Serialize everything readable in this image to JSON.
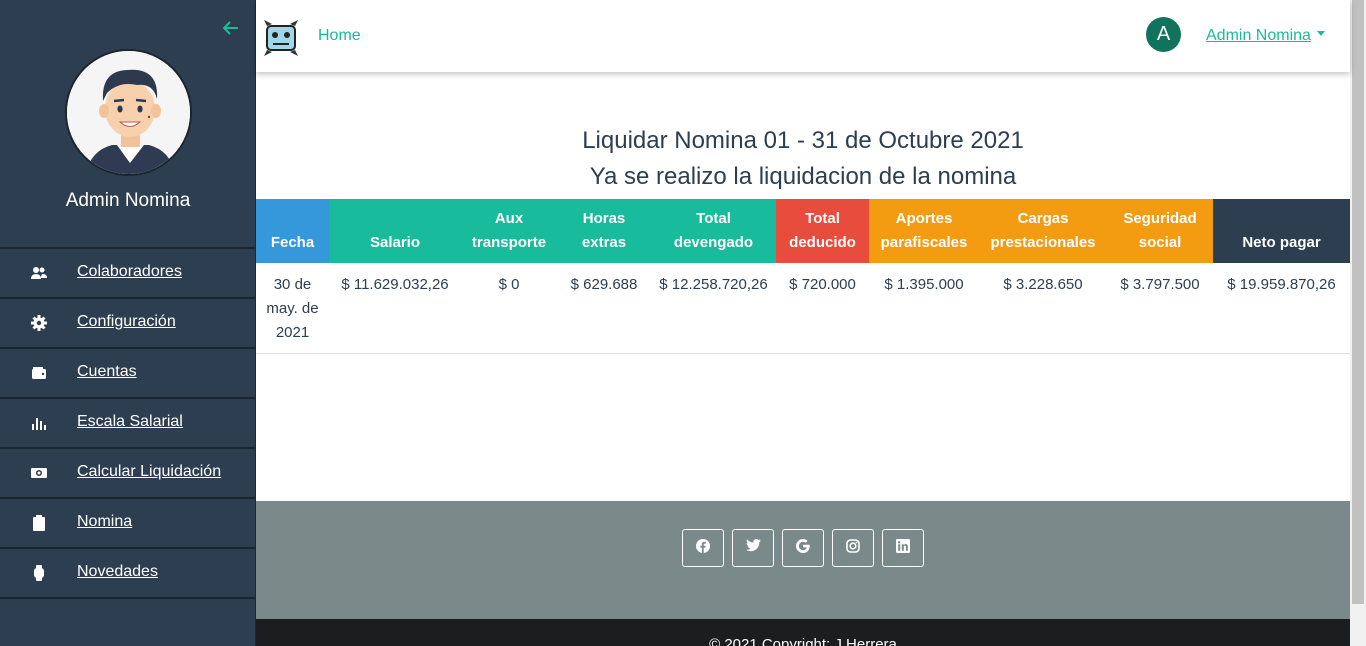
{
  "sidebar": {
    "back_icon": "arrow-left-icon",
    "user_name": "Admin Nomina",
    "items": [
      {
        "label": "Colaboradores",
        "icon": "users-icon"
      },
      {
        "label": "Configuración",
        "icon": "gear-icon"
      },
      {
        "label": "Cuentas",
        "icon": "wallet-icon"
      },
      {
        "label": "Escala Salarial",
        "icon": "bar-chart-icon"
      },
      {
        "label": "Calcular Liquidación",
        "icon": "money-icon"
      },
      {
        "label": "Nomina",
        "icon": "clipboard-icon"
      },
      {
        "label": "Novedades",
        "icon": "watch-icon"
      }
    ]
  },
  "navbar": {
    "home_label": "Home",
    "user_initial": "A",
    "user_menu_label": "Admin Nomina"
  },
  "main": {
    "title": "Liquidar Nomina 01 - 31 de Octubre 2021",
    "subtitle": "Ya se realizo la liquidacion de la nomina",
    "table": {
      "headers": [
        {
          "label": "Fecha",
          "color": "#3498db"
        },
        {
          "label": "Salario",
          "color": "#18bc9c"
        },
        {
          "label": "Aux transporte",
          "color": "#18bc9c"
        },
        {
          "label": "Horas extras",
          "color": "#18bc9c"
        },
        {
          "label": "Total devengado",
          "color": "#18bc9c"
        },
        {
          "label": "Total deducido",
          "color": "#e74c3c"
        },
        {
          "label": "Aportes parafiscales",
          "color": "#f39c12"
        },
        {
          "label": "Cargas prestacionales",
          "color": "#f39c12"
        },
        {
          "label": "Seguridad social",
          "color": "#f39c12"
        },
        {
          "label": "Neto pagar",
          "color": "#2c3e50"
        }
      ],
      "rows": [
        [
          "30 de may. de 2021",
          "$ 11.629.032,26",
          "$ 0",
          "$ 629.688",
          "$ 12.258.720,26",
          "$ 720.000",
          "$ 1.395.000",
          "$ 3.228.650",
          "$ 3.797.500",
          "$ 19.959.870,26"
        ]
      ]
    }
  },
  "footer": {
    "social": [
      "facebook-icon",
      "twitter-icon",
      "google-icon",
      "instagram-icon",
      "linkedin-icon"
    ],
    "copyright": "© 2021 Copyright: J.Herrera"
  }
}
